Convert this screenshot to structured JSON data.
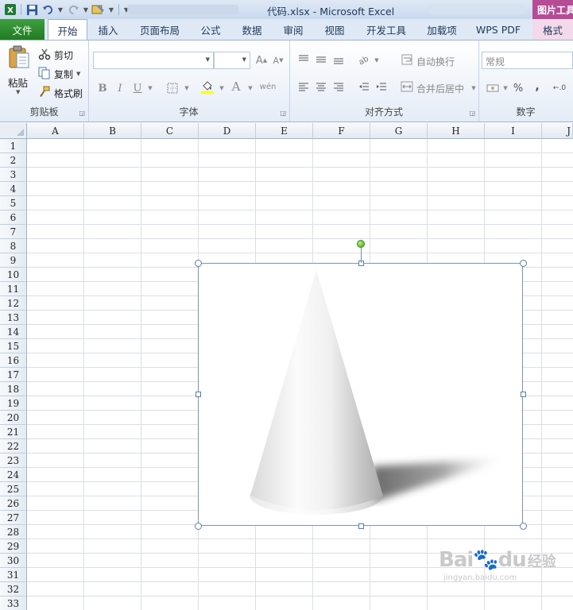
{
  "window": {
    "title": "代码.xlsx  -  Microsoft Excel",
    "context_tab": "图片工具"
  },
  "tabs": [
    {
      "label": "文件"
    },
    {
      "label": "开始"
    },
    {
      "label": "插入"
    },
    {
      "label": "页面布局"
    },
    {
      "label": "公式"
    },
    {
      "label": "数据"
    },
    {
      "label": "审阅"
    },
    {
      "label": "视图"
    },
    {
      "label": "开发工具"
    },
    {
      "label": "加载项"
    },
    {
      "label": "WPS PDF"
    },
    {
      "label": "格式"
    }
  ],
  "ribbon": {
    "clipboard": {
      "label": "剪贴板",
      "paste": "粘贴",
      "cut": "剪切",
      "copy": "复制",
      "format_painter": "格式刷"
    },
    "font": {
      "label": "字体"
    },
    "alignment": {
      "label": "对齐方式",
      "wrap_text": "自动换行",
      "merge_center": "合并后居中"
    },
    "number": {
      "label": "数字",
      "format": "常规",
      "percent": "%",
      "comma": ","
    }
  },
  "sheet": {
    "columns": [
      "A",
      "B",
      "C",
      "D",
      "E",
      "F",
      "G",
      "H",
      "I",
      "J"
    ],
    "rows": [
      "1",
      "2",
      "3",
      "4",
      "5",
      "6",
      "7",
      "8",
      "9",
      "10",
      "11",
      "12",
      "13",
      "14",
      "15",
      "16",
      "17",
      "18",
      "19",
      "20",
      "21",
      "22",
      "23",
      "24",
      "25",
      "26",
      "27",
      "28",
      "29",
      "30",
      "31",
      "32",
      "33"
    ]
  },
  "watermark": {
    "brand": "Bai",
    "brand_suffix": "du",
    "brand_cn": "经验",
    "url": "jingyan.baidu.com"
  }
}
